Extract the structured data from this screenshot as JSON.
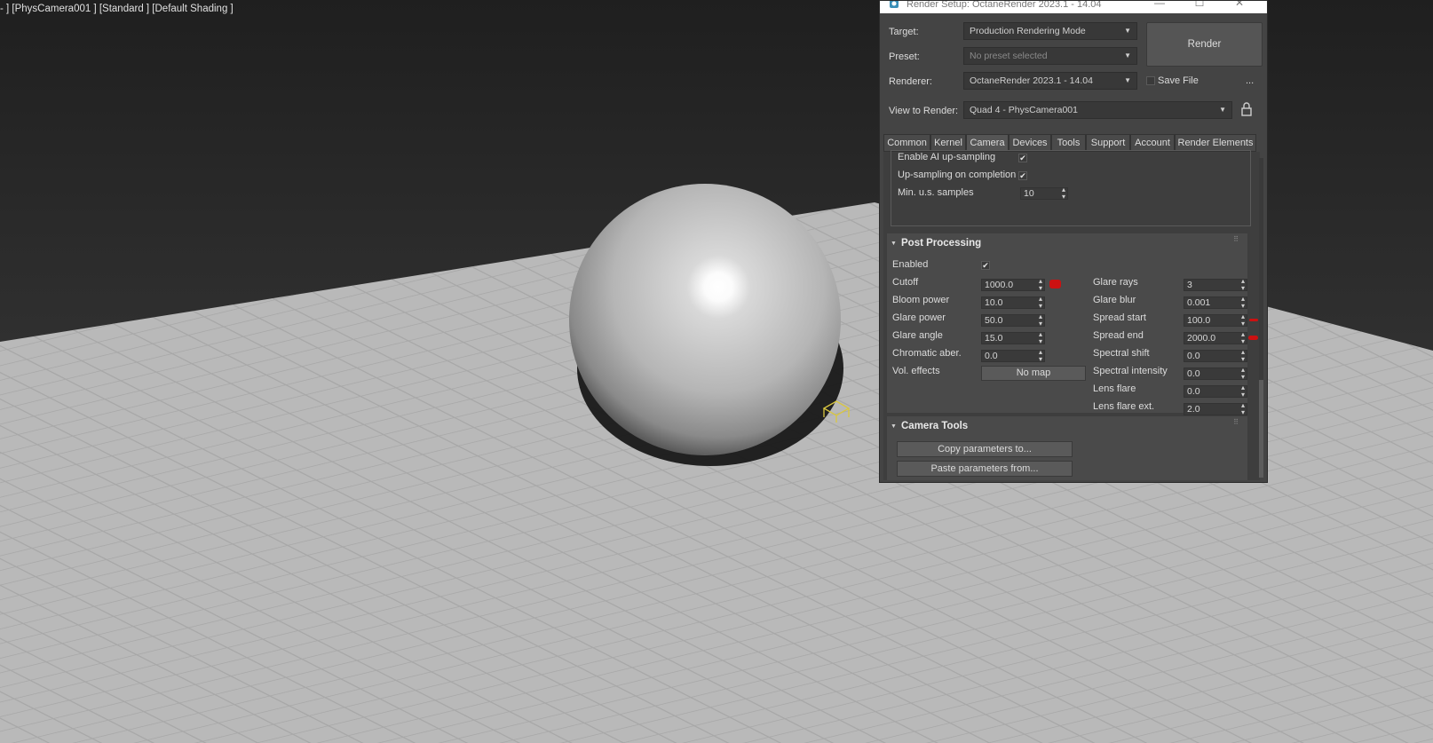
{
  "viewport": {
    "label": "- ] [PhysCamera001 ] [Standard ] [Default Shading ]"
  },
  "dialog": {
    "title": "Render Setup: OctaneRender 2023.1 - 14.04",
    "target_label": "Target:",
    "target_value": "Production Rendering Mode",
    "preset_label": "Preset:",
    "preset_value": "No preset selected",
    "renderer_label": "Renderer:",
    "renderer_value": "OctaneRender 2023.1 - 14.04",
    "save_file_label": "Save File",
    "more_label": "...",
    "render_button": "Render",
    "view_label": "View to Render:",
    "view_value": "Quad 4 - PhysCamera001",
    "tabs": [
      {
        "label": "Common"
      },
      {
        "label": "Kernel"
      },
      {
        "label": "Camera",
        "active": true
      },
      {
        "label": "Devices"
      },
      {
        "label": "Tools"
      },
      {
        "label": "Support"
      },
      {
        "label": "Account"
      },
      {
        "label": "Render Elements"
      }
    ],
    "upsampling": {
      "enable_label": "Enable AI up-sampling",
      "completion_label": "Up-sampling on completion",
      "min_samples_label": "Min. u.s. samples",
      "min_samples_value": "10"
    },
    "post_processing": {
      "title": "Post Processing",
      "enabled_label": "Enabled",
      "left": [
        {
          "label": "Cutoff",
          "value": "1000.0"
        },
        {
          "label": "Bloom power",
          "value": "10.0"
        },
        {
          "label": "Glare power",
          "value": "50.0"
        },
        {
          "label": "Glare angle",
          "value": "15.0"
        },
        {
          "label": "Chromatic aber.",
          "value": "0.0"
        }
      ],
      "vol_effects_label": "Vol. effects",
      "vol_effects_button": "No map",
      "right": [
        {
          "label": "Glare rays",
          "value": "3"
        },
        {
          "label": "Glare blur",
          "value": "0.001"
        },
        {
          "label": "Spread start",
          "value": "100.0"
        },
        {
          "label": "Spread end",
          "value": "2000.0"
        },
        {
          "label": "Spectral shift",
          "value": "0.0"
        },
        {
          "label": "Spectral intensity",
          "value": "0.0"
        },
        {
          "label": "Lens flare",
          "value": "0.0"
        },
        {
          "label": "Lens flare ext.",
          "value": "2.0"
        }
      ]
    },
    "camera_tools": {
      "title": "Camera Tools",
      "copy_button": "Copy parameters to...",
      "paste_button": "Paste parameters from..."
    }
  },
  "colors": {
    "dialog_bg": "#444444",
    "annotation_red": "#cc1111",
    "camera_icon": "#d9c640"
  }
}
